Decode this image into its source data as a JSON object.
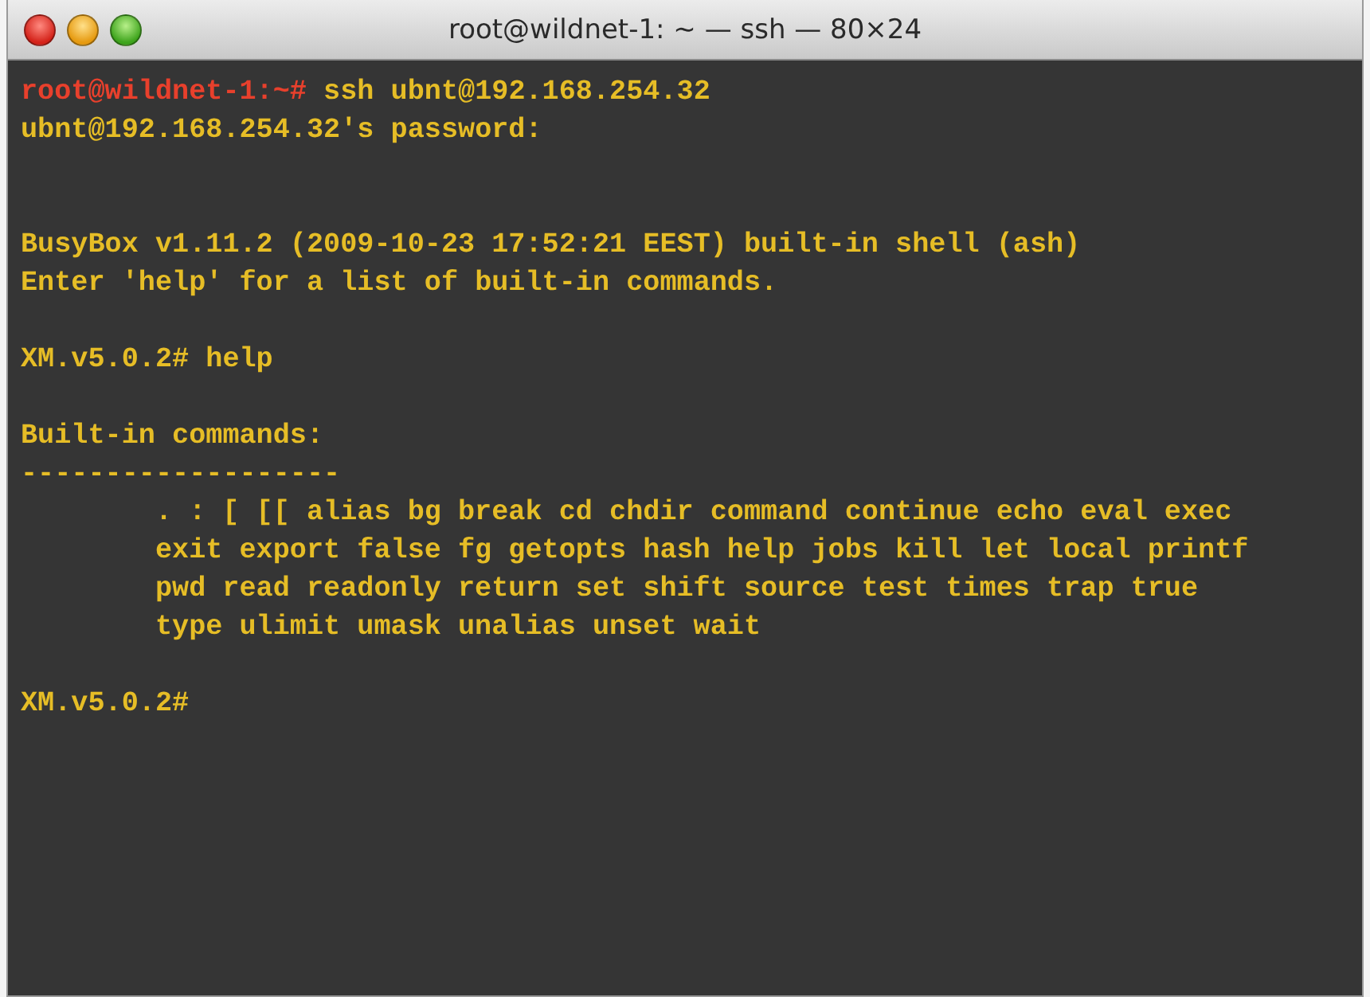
{
  "window": {
    "title": "root@wildnet-1: ~ — ssh — 80×24"
  },
  "terminal": {
    "lines": [
      {
        "kind": "command",
        "segments": [
          {
            "kind": "prompt",
            "text": "root@wildnet-1:~#"
          },
          {
            "kind": "input",
            "text": " ssh ubnt@192.168.254.32"
          }
        ]
      },
      {
        "kind": "output",
        "segments": [
          {
            "kind": "output",
            "text": "ubnt@192.168.254.32's password:"
          }
        ]
      },
      {
        "kind": "blank"
      },
      {
        "kind": "blank"
      },
      {
        "kind": "output",
        "segments": [
          {
            "kind": "output",
            "text": "BusyBox v1.11.2 (2009-10-23 17:52:21 EEST) built-in shell (ash)"
          }
        ]
      },
      {
        "kind": "output",
        "segments": [
          {
            "kind": "output",
            "text": "Enter 'help' for a list of built-in commands."
          }
        ]
      },
      {
        "kind": "blank"
      },
      {
        "kind": "command",
        "segments": [
          {
            "kind": "output",
            "text": "XM.v5.0.2# help"
          }
        ]
      },
      {
        "kind": "blank"
      },
      {
        "kind": "output",
        "segments": [
          {
            "kind": "output",
            "text": "Built-in commands:"
          }
        ]
      },
      {
        "kind": "output",
        "segments": [
          {
            "kind": "output",
            "text": "-------------------"
          }
        ]
      },
      {
        "kind": "indented",
        "segments": [
          {
            "kind": "output",
            "text": ". : [ [[ alias bg break cd chdir command continue echo eval exec"
          }
        ]
      },
      {
        "kind": "indented",
        "segments": [
          {
            "kind": "output",
            "text": "exit export false fg getopts hash help jobs kill let local printf"
          }
        ]
      },
      {
        "kind": "indented",
        "segments": [
          {
            "kind": "output",
            "text": "pwd read readonly return set shift source test times trap true"
          }
        ]
      },
      {
        "kind": "indented",
        "segments": [
          {
            "kind": "output",
            "text": "type ulimit umask unalias unset wait"
          }
        ]
      },
      {
        "kind": "blank"
      },
      {
        "kind": "command",
        "segments": [
          {
            "kind": "output",
            "text": "XM.v5.0.2#"
          }
        ]
      }
    ]
  }
}
